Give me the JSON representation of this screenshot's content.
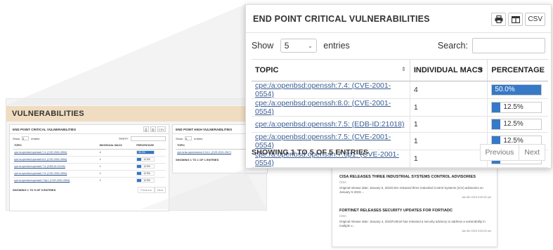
{
  "background": {
    "section_title": "VULNERABILITIES",
    "critical_card": {
      "title": "END POINT CRITICAL VULNERABILITIES",
      "print_label": "⎙",
      "columns_label": "▥",
      "csv_label": "CSV",
      "show_label": "Show",
      "show_value": "5",
      "entries_label": "entries",
      "search_label": "Search:",
      "headers": [
        "TOPIC",
        "INDIVIDUAL MACS",
        "PERCENTAGE"
      ],
      "rows": [
        {
          "topic": "cpe:/a:openbsd:openssh:7.4: (CVE-2001-0554)",
          "macs": "4",
          "pct": "50.0%",
          "fill": 100
        },
        {
          "topic": "cpe:/a:openbsd:openssh:8.0: (CVE-2001-0554)",
          "macs": "1",
          "pct": "12.5%",
          "fill": 20
        },
        {
          "topic": "cpe:/a:openbsd:openssh:7.5: (EDB-ID:21018)",
          "macs": "1",
          "pct": "12.5%",
          "fill": 20
        },
        {
          "topic": "cpe:/a:openbsd:openssh:7.5: (CVE-2001-0554)",
          "macs": "1",
          "pct": "12.5%",
          "fill": 20
        },
        {
          "topic": "cpe:/a:openbsd:openssh:7.6p1: (CVE-2001-0554)",
          "macs": "1",
          "pct": "12.5%",
          "fill": 20
        }
      ],
      "info": "SHOWING 1 TO 5 OF 5 ENTRIES",
      "prev": "Previous",
      "next": "Next"
    },
    "high_card": {
      "title": "END POINT HIGH VULNERABILITIES",
      "show_label": "Show",
      "show_value": "5",
      "entries_label": "entries",
      "header": "TOPIC",
      "row": "cpe:/a:isc:openresolve:2.16.1: (CVE-2021-2517)",
      "info": "SHOWING 1 TO 1 OF 1 ENTRIES"
    }
  },
  "news": [
    {
      "title": "CISA RELEASES THREE INDUSTRIAL SYSTEMS CONTROL ADVISORIES",
      "source": "CISA",
      "body": "Original release date: January 5, 2023CISA released three Industrial Control Systems (ICS) advisories on January 5 2023....",
      "date": "Jan 5th 2023 4:00:00 pm"
    },
    {
      "title": "FORTINET RELEASES SECURITY UPDATES FOR FORTIADC",
      "source": "CISA",
      "body": "Original release date: January 4, 2023Fortinet has released a security advisory to address a vulnerability in multiple v...",
      "date": "Jan 4th 2023 3:25:00 pm"
    }
  ],
  "card": {
    "title": "END POINT CRITICAL VULNERABILITIES",
    "print_icon": "print-icon",
    "columns_icon": "columns-icon",
    "csv_label": "CSV",
    "show_label": "Show",
    "show_value": "5",
    "entries_label": "entries",
    "search_label": "Search:",
    "search_value": "",
    "headers": {
      "topic": "TOPIC",
      "macs": "INDIVIDUAL MACS",
      "percentage": "PERCENTAGE"
    },
    "rows": [
      {
        "topic": "cpe:/a:openbsd:openssh:7.4: (CVE-2001-0554)",
        "macs": "4",
        "pct": "50.0%",
        "fill_fraction": 1.0
      },
      {
        "topic": "cpe:/a:openbsd:openssh:8.0: (CVE-2001-0554)",
        "macs": "1",
        "pct": "12.5%",
        "fill_fraction": 0.125
      },
      {
        "topic": "cpe:/a:openbsd:openssh:7.5: (EDB-ID:21018)",
        "macs": "1",
        "pct": "12.5%",
        "fill_fraction": 0.125
      },
      {
        "topic": "cpe:/a:openbsd:openssh:7.5: (CVE-2001-0554)",
        "macs": "1",
        "pct": "12.5%",
        "fill_fraction": 0.125
      },
      {
        "topic": "cpe:/a:openbsd:openssh:7.6p1: (CVE-2001-0554)",
        "macs": "1",
        "pct": "12.5%",
        "fill_fraction": 0.125
      }
    ],
    "info": "SHOWING 1 TO 5 OF 5 ENTRIES",
    "prev": "Previous",
    "next": "Next"
  },
  "colors": {
    "accent_blue": "#3679c6",
    "link_blue": "#3a5c93",
    "section_band": "#f0dcc0"
  }
}
